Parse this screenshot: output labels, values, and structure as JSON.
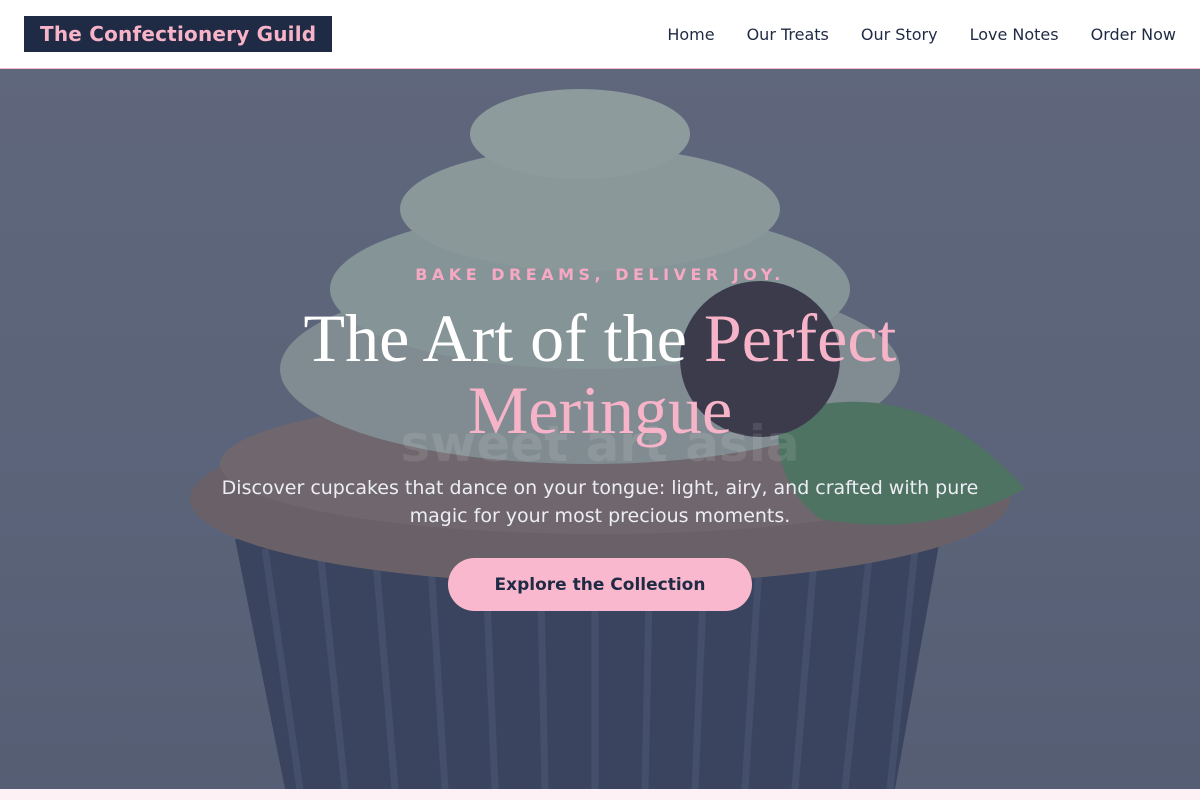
{
  "header": {
    "brand": "The Confectionery Guild",
    "nav": [
      {
        "label": "Home"
      },
      {
        "label": "Our Treats"
      },
      {
        "label": "Our Story"
      },
      {
        "label": "Love Notes"
      },
      {
        "label": "Order Now"
      }
    ]
  },
  "hero": {
    "tagline": "BAKE DREAMS, DELIVER JOY.",
    "headline_plain": "The Art of the ",
    "headline_accent": "Perfect Meringue",
    "subtitle": "Discover cupcakes that dance on your tongue: light, airy, and crafted with pure magic for your most precious moments.",
    "cta_label": "Explore the Collection",
    "watermark": "sweet art asia"
  },
  "colors": {
    "brand_bg": "#1f2a44",
    "accent_pink": "#f7b3c8",
    "header_border": "#f4b6cc"
  }
}
